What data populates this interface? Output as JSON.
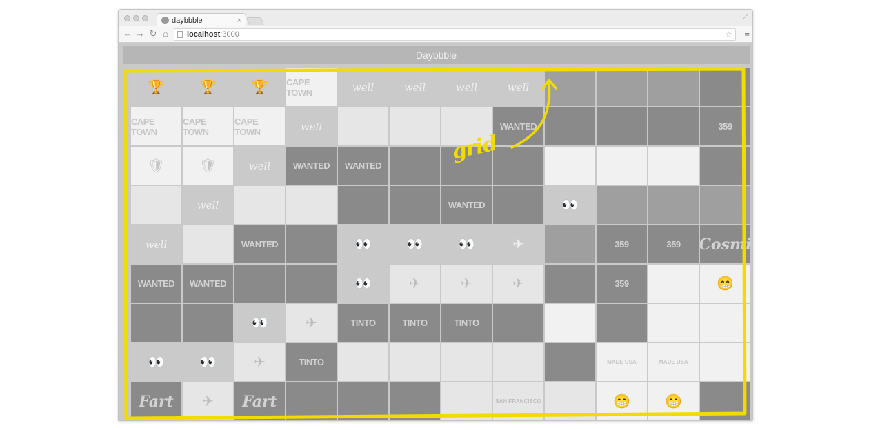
{
  "browser": {
    "tab_title": "daybbble",
    "tab_close": "×",
    "url_host": "localhost",
    "url_port": ":3000"
  },
  "app": {
    "title": "Daybbble"
  },
  "annotation": {
    "label": "grid",
    "color": "#f2dc00"
  },
  "grid": {
    "columns": 12,
    "rows": 9,
    "shots": [
      {
        "tone": "c-mid",
        "glyph": "🏆",
        "text": ""
      },
      {
        "tone": "c-mid",
        "glyph": "🏆",
        "text": ""
      },
      {
        "tone": "c-mid",
        "glyph": "🏆",
        "text": ""
      },
      {
        "tone": "c-white",
        "glyph": "",
        "text": "CAPE TOWN"
      },
      {
        "tone": "c-mid",
        "glyph": "",
        "text": "well"
      },
      {
        "tone": "c-mid",
        "glyph": "",
        "text": "well"
      },
      {
        "tone": "c-mid",
        "glyph": "",
        "text": "well"
      },
      {
        "tone": "c-mid",
        "glyph": "",
        "text": "well"
      },
      {
        "tone": "c-dark",
        "glyph": "",
        "text": ""
      },
      {
        "tone": "c-dark",
        "glyph": "",
        "text": ""
      },
      {
        "tone": "c-dark",
        "glyph": "",
        "text": ""
      },
      {
        "tone": "c-darker",
        "glyph": "",
        "text": ""
      },
      {
        "tone": "c-white",
        "glyph": "",
        "text": "CAPE TOWN"
      },
      {
        "tone": "c-white",
        "glyph": "",
        "text": "CAPE TOWN"
      },
      {
        "tone": "c-white",
        "glyph": "",
        "text": "CAPE TOWN"
      },
      {
        "tone": "c-mid",
        "glyph": "",
        "text": "well"
      },
      {
        "tone": "c-light",
        "glyph": "",
        "text": ""
      },
      {
        "tone": "c-light",
        "glyph": "",
        "text": ""
      },
      {
        "tone": "c-light",
        "glyph": "",
        "text": ""
      },
      {
        "tone": "c-darker",
        "glyph": "",
        "text": "WANTED"
      },
      {
        "tone": "c-darker",
        "glyph": "",
        "text": ""
      },
      {
        "tone": "c-darker",
        "glyph": "",
        "text": ""
      },
      {
        "tone": "c-darker",
        "glyph": "",
        "text": ""
      },
      {
        "tone": "c-darker",
        "glyph": "",
        "text": "359"
      },
      {
        "tone": "c-white",
        "glyph": "🛡",
        "text": ""
      },
      {
        "tone": "c-white",
        "glyph": "🛡",
        "text": ""
      },
      {
        "tone": "c-mid",
        "glyph": "",
        "text": "well"
      },
      {
        "tone": "c-darker",
        "glyph": "",
        "text": "WANTED"
      },
      {
        "tone": "c-darker",
        "glyph": "",
        "text": "WANTED"
      },
      {
        "tone": "c-darker",
        "glyph": "",
        "text": ""
      },
      {
        "tone": "c-darker",
        "glyph": "",
        "text": ""
      },
      {
        "tone": "c-darker",
        "glyph": "",
        "text": ""
      },
      {
        "tone": "c-white",
        "glyph": "",
        "text": ""
      },
      {
        "tone": "c-white",
        "glyph": "",
        "text": ""
      },
      {
        "tone": "c-white",
        "glyph": "",
        "text": ""
      },
      {
        "tone": "c-darker",
        "glyph": "",
        "text": ""
      },
      {
        "tone": "c-light",
        "glyph": "",
        "text": ""
      },
      {
        "tone": "c-mid",
        "glyph": "",
        "text": "well"
      },
      {
        "tone": "c-light",
        "glyph": "",
        "text": ""
      },
      {
        "tone": "c-light",
        "glyph": "",
        "text": ""
      },
      {
        "tone": "c-darker",
        "glyph": "",
        "text": ""
      },
      {
        "tone": "c-darker",
        "glyph": "",
        "text": ""
      },
      {
        "tone": "c-darker",
        "glyph": "",
        "text": "WANTED"
      },
      {
        "tone": "c-darker",
        "glyph": "",
        "text": ""
      },
      {
        "tone": "c-mid",
        "glyph": "👀",
        "text": ""
      },
      {
        "tone": "c-dark",
        "glyph": "",
        "text": ""
      },
      {
        "tone": "c-dark",
        "glyph": "",
        "text": ""
      },
      {
        "tone": "c-dark",
        "glyph": "",
        "text": ""
      },
      {
        "tone": "c-mid",
        "glyph": "",
        "text": "well"
      },
      {
        "tone": "c-light",
        "glyph": "",
        "text": ""
      },
      {
        "tone": "c-darker",
        "glyph": "",
        "text": "WANTED"
      },
      {
        "tone": "c-darker",
        "glyph": "",
        "text": ""
      },
      {
        "tone": "c-mid",
        "glyph": "👀",
        "text": ""
      },
      {
        "tone": "c-mid",
        "glyph": "👀",
        "text": ""
      },
      {
        "tone": "c-mid",
        "glyph": "👀",
        "text": ""
      },
      {
        "tone": "c-mid",
        "glyph": "✈",
        "text": ""
      },
      {
        "tone": "c-dark",
        "glyph": "",
        "text": ""
      },
      {
        "tone": "c-darker",
        "glyph": "",
        "text": "359"
      },
      {
        "tone": "c-darker",
        "glyph": "",
        "text": "359"
      },
      {
        "tone": "c-darker",
        "glyph": "",
        "text": "Cosmi"
      },
      {
        "tone": "c-darker",
        "glyph": "",
        "text": "WANTED"
      },
      {
        "tone": "c-darker",
        "glyph": "",
        "text": "WANTED"
      },
      {
        "tone": "c-darker",
        "glyph": "",
        "text": ""
      },
      {
        "tone": "c-darker",
        "glyph": "",
        "text": ""
      },
      {
        "tone": "c-mid",
        "glyph": "👀",
        "text": ""
      },
      {
        "tone": "c-light",
        "glyph": "✈",
        "text": ""
      },
      {
        "tone": "c-light",
        "glyph": "✈",
        "text": ""
      },
      {
        "tone": "c-light",
        "glyph": "✈",
        "text": ""
      },
      {
        "tone": "c-darker",
        "glyph": "",
        "text": ""
      },
      {
        "tone": "c-darker",
        "glyph": "",
        "text": "359"
      },
      {
        "tone": "c-white",
        "glyph": "",
        "text": ""
      },
      {
        "tone": "c-white",
        "glyph": "😁",
        "text": ""
      },
      {
        "tone": "c-darker",
        "glyph": "",
        "text": ""
      },
      {
        "tone": "c-darker",
        "glyph": "",
        "text": ""
      },
      {
        "tone": "c-mid",
        "glyph": "👀",
        "text": ""
      },
      {
        "tone": "c-light",
        "glyph": "✈",
        "text": ""
      },
      {
        "tone": "c-darker",
        "glyph": "",
        "text": "TINTO"
      },
      {
        "tone": "c-darker",
        "glyph": "",
        "text": "TINTO"
      },
      {
        "tone": "c-darker",
        "glyph": "",
        "text": "TINTO"
      },
      {
        "tone": "c-darker",
        "glyph": "",
        "text": ""
      },
      {
        "tone": "c-white",
        "glyph": "",
        "text": ""
      },
      {
        "tone": "c-darker",
        "glyph": "",
        "text": ""
      },
      {
        "tone": "c-white",
        "glyph": "",
        "text": ""
      },
      {
        "tone": "c-white",
        "glyph": "",
        "text": ""
      },
      {
        "tone": "c-mid",
        "glyph": "👀",
        "text": ""
      },
      {
        "tone": "c-mid",
        "glyph": "👀",
        "text": ""
      },
      {
        "tone": "c-light",
        "glyph": "✈",
        "text": ""
      },
      {
        "tone": "c-darker",
        "glyph": "",
        "text": "TINTO"
      },
      {
        "tone": "c-light",
        "glyph": "",
        "text": ""
      },
      {
        "tone": "c-light",
        "glyph": "",
        "text": ""
      },
      {
        "tone": "c-light",
        "glyph": "",
        "text": ""
      },
      {
        "tone": "c-light",
        "glyph": "",
        "text": ""
      },
      {
        "tone": "c-darker",
        "glyph": "",
        "text": ""
      },
      {
        "tone": "c-white",
        "glyph": "",
        "text": "MADE USA"
      },
      {
        "tone": "c-white",
        "glyph": "",
        "text": "MADE USA"
      },
      {
        "tone": "c-white",
        "glyph": "",
        "text": ""
      },
      {
        "tone": "c-darker",
        "glyph": "",
        "text": "Fart"
      },
      {
        "tone": "c-light",
        "glyph": "✈",
        "text": ""
      },
      {
        "tone": "c-darker",
        "glyph": "",
        "text": "Fart"
      },
      {
        "tone": "c-darker",
        "glyph": "",
        "text": ""
      },
      {
        "tone": "c-darker",
        "glyph": "",
        "text": ""
      },
      {
        "tone": "c-darker",
        "glyph": "",
        "text": ""
      },
      {
        "tone": "c-light",
        "glyph": "",
        "text": ""
      },
      {
        "tone": "c-light",
        "glyph": "",
        "text": "SAN FRANCISCO"
      },
      {
        "tone": "c-light",
        "glyph": "",
        "text": ""
      },
      {
        "tone": "c-white",
        "glyph": "😁",
        "text": ""
      },
      {
        "tone": "c-white",
        "glyph": "😁",
        "text": ""
      },
      {
        "tone": "c-darker",
        "glyph": "",
        "text": ""
      }
    ]
  }
}
